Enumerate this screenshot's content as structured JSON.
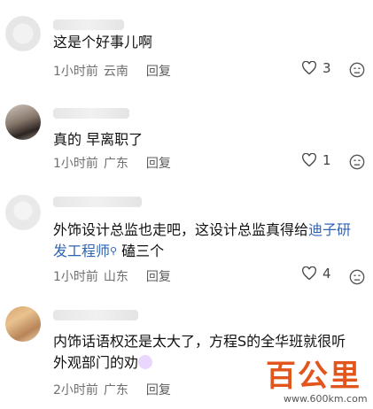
{
  "comments": [
    {
      "text": "这是个好事儿啊",
      "time": "1小时前",
      "location": "云南",
      "reply": "回复",
      "likes": "3"
    },
    {
      "text": "真的 早离职了",
      "time": "1小时前",
      "location": "广东",
      "reply": "回复",
      "likes": "1"
    },
    {
      "text_line1_a": "外饰设计总监也走吧，这设计总监真得给",
      "text_line1_link": "迪子研",
      "text_line2_link": "发工程师",
      "text_line2_b": "磕三个",
      "time": "1小时前",
      "location": "山东",
      "reply": "回复",
      "likes": "4"
    },
    {
      "text_line1": "内饰话语权还是太大了，方程S的全华班就很听",
      "text_line2": "外观部门的劝",
      "time": "2小时前",
      "location": "广东",
      "reply": "回复"
    }
  ],
  "watermark": {
    "logo": "百公里",
    "url": "www.600km.com"
  },
  "colors": {
    "link": "#2f64b4",
    "meta": "#6f6f6f",
    "watermark": "#e2561e"
  }
}
